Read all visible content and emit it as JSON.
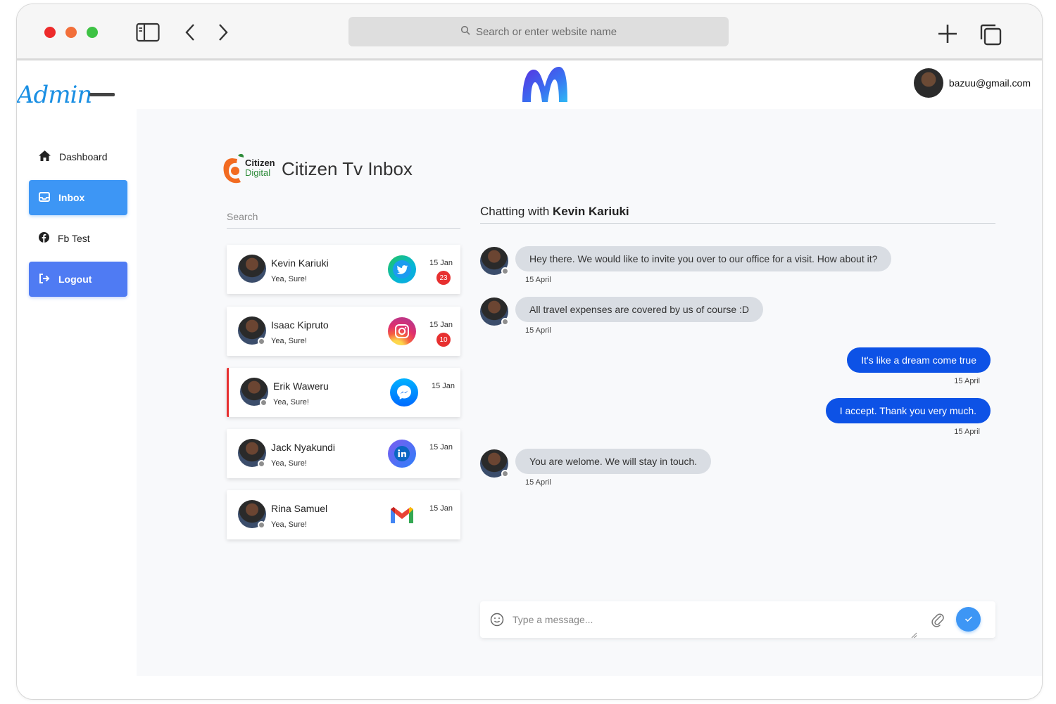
{
  "browser": {
    "url_placeholder": "Search or enter website name"
  },
  "header": {
    "brand": "Admin",
    "user_email": "bazuu@gmail.com"
  },
  "sidebar": {
    "items": [
      {
        "label": "Dashboard",
        "icon": "home-icon"
      },
      {
        "label": "Inbox",
        "icon": "inbox-icon"
      },
      {
        "label": "Fb Test",
        "icon": "facebook-icon"
      },
      {
        "label": "Logout",
        "icon": "logout-icon"
      }
    ]
  },
  "inbox": {
    "logo_text_1": "Citizen",
    "logo_text_2": "Digital",
    "title": "Citizen Tv Inbox",
    "search_placeholder": "Search"
  },
  "conversations": [
    {
      "name": "Kevin Kariuki",
      "preview": "Yea, Sure!",
      "date": "15 Jan",
      "unread": "23",
      "source": "twitter"
    },
    {
      "name": "Isaac Kipruto",
      "preview": "Yea, Sure!",
      "date": "15 Jan",
      "unread": "10",
      "source": "instagram"
    },
    {
      "name": "Erik Waweru",
      "preview": "Yea, Sure!",
      "date": "15 Jan",
      "unread": "",
      "source": "messenger"
    },
    {
      "name": "Jack Nyakundi",
      "preview": "Yea, Sure!",
      "date": "15 Jan",
      "unread": "",
      "source": "linkedin"
    },
    {
      "name": "Rina Samuel",
      "preview": "Yea, Sure!",
      "date": "15 Jan",
      "unread": "",
      "source": "gmail"
    }
  ],
  "chat": {
    "header_prefix": "Chatting with",
    "contact": "Kevin Kariuki",
    "messages": [
      {
        "direction": "in",
        "text": "Hey there. We would like to invite you over to our office for a visit. How about it?",
        "time": "15 April"
      },
      {
        "direction": "in",
        "text": "All travel expenses are covered by us of course :D",
        "time": "15 April"
      },
      {
        "direction": "out",
        "text": "It's like a dream come true",
        "time": "15 April"
      },
      {
        "direction": "out",
        "text": "I accept. Thank you very much.",
        "time": "15 April"
      },
      {
        "direction": "in",
        "text": "You are welome. We will stay in touch.",
        "time": "15 April"
      }
    ],
    "composer_placeholder": "Type a message..."
  },
  "colors": {
    "primary": "#3d96f5",
    "logout": "#4f7bf3",
    "outgoing_bubble": "#0d52e6",
    "incoming_bubble": "#d9dde3",
    "badge": "#e73030"
  }
}
